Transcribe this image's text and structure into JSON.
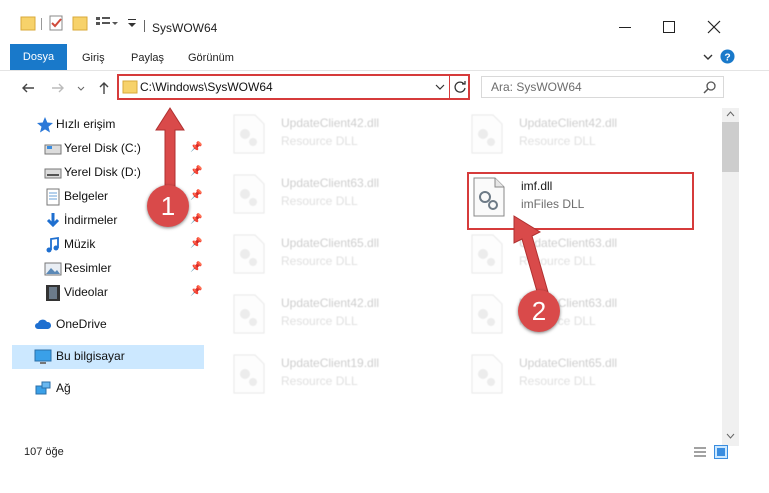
{
  "window": {
    "title": "SysWOW64"
  },
  "ribbon": {
    "tabs": [
      "Dosya",
      "Giriş",
      "Paylaş",
      "Görünüm"
    ]
  },
  "address": {
    "path": "C:\\Windows\\SysWOW64"
  },
  "search": {
    "placeholder": "Ara: SysWOW64"
  },
  "sidebar": {
    "items": [
      {
        "label": "Hızlı erişim",
        "icon": "star-icon"
      },
      {
        "label": "Yerel Disk (C:)",
        "icon": "drive-icon"
      },
      {
        "label": "Yerel Disk (D:)",
        "icon": "drive-icon"
      },
      {
        "label": "Belgeler",
        "icon": "documents-icon"
      },
      {
        "label": "İndirmeler",
        "icon": "download-icon"
      },
      {
        "label": "Müzik",
        "icon": "music-icon"
      },
      {
        "label": "Resimler",
        "icon": "pictures-icon"
      },
      {
        "label": "Videolar",
        "icon": "videos-icon"
      },
      {
        "label": "OneDrive",
        "icon": "cloud-icon"
      },
      {
        "label": "Bu bilgisayar",
        "icon": "computer-icon"
      },
      {
        "label": "Ağ",
        "icon": "network-icon"
      }
    ]
  },
  "files": [
    {
      "name": "UpdateClient42.dll",
      "desc": "Resource DLL"
    },
    {
      "name": "UpdateClient42.dll",
      "desc": "Resource DLL"
    },
    {
      "name": "UpdateClient63.dll",
      "desc": "Resource DLL"
    },
    {
      "name": "imf.dll",
      "desc": "imFiles DLL"
    },
    {
      "name": "UpdateClient65.dll",
      "desc": "Resource DLL"
    },
    {
      "name": "UpdateClient63.dll",
      "desc": "Resource DLL"
    },
    {
      "name": "UpdateClient42.dll",
      "desc": "Resource DLL"
    },
    {
      "name": "UpdateClient63.dll",
      "desc": "Resource DLL"
    },
    {
      "name": "UpdateClient19.dll",
      "desc": "Resource DLL"
    },
    {
      "name": "UpdateClient65.dll",
      "desc": "Resource DLL"
    }
  ],
  "annotations": {
    "step1": "1",
    "step2": "2"
  },
  "status": {
    "count": "107 öğe"
  },
  "colors": {
    "accent": "#1979ca",
    "highlight": "#d63b3b",
    "selection": "#cce8ff"
  }
}
